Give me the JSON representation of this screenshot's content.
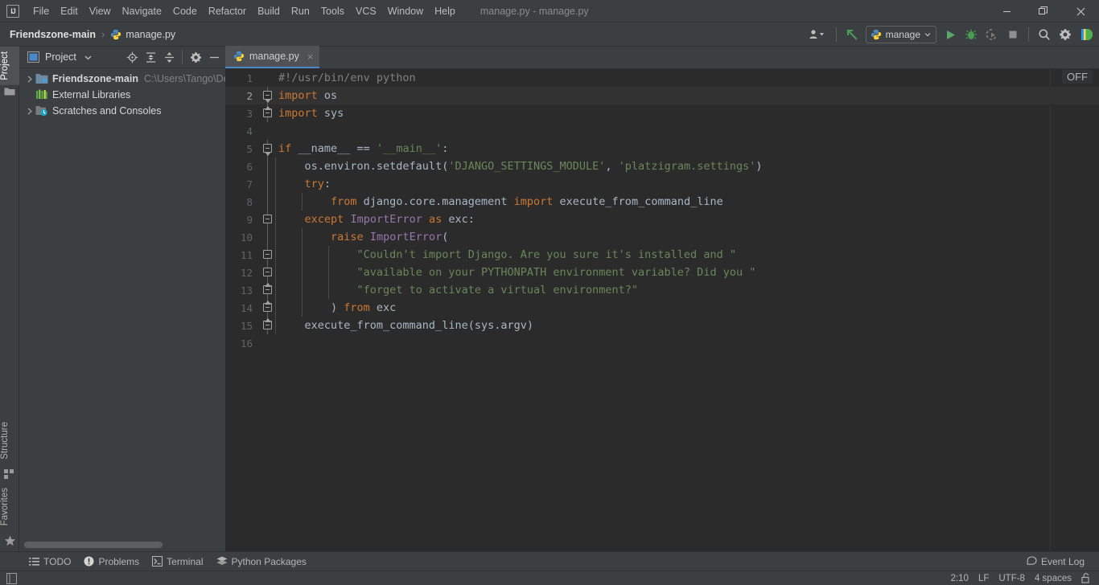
{
  "window": {
    "title": "manage.py - manage.py",
    "controls": {
      "minimize": "minimize-button",
      "maximize": "restore-button",
      "close": "close-button"
    }
  },
  "menubar": {
    "items": [
      {
        "label": "File"
      },
      {
        "label": "Edit"
      },
      {
        "label": "View"
      },
      {
        "label": "Navigate"
      },
      {
        "label": "Code"
      },
      {
        "label": "Refactor"
      },
      {
        "label": "Build"
      },
      {
        "label": "Run"
      },
      {
        "label": "Tools"
      },
      {
        "label": "VCS"
      },
      {
        "label": "Window"
      },
      {
        "label": "Help"
      }
    ]
  },
  "navbar": {
    "breadcrumb": [
      {
        "label": "Friendszone-main",
        "bold": true
      },
      {
        "label": "manage.py",
        "bold": false
      }
    ],
    "separator": "›",
    "run_config": {
      "label": "manage"
    },
    "buttons": [
      {
        "name": "user-accounts-icon",
        "tooltip": "Account"
      },
      {
        "name": "update-project-icon",
        "tooltip": "Update Project"
      },
      {
        "name": "run-button",
        "tooltip": "Run"
      },
      {
        "name": "debug-button",
        "tooltip": "Debug"
      },
      {
        "name": "run-with-coverage-button",
        "tooltip": "Run with Coverage"
      },
      {
        "name": "stop-button",
        "tooltip": "Stop"
      },
      {
        "name": "search-everywhere-icon",
        "tooltip": "Search Everywhere"
      },
      {
        "name": "settings-gear-icon",
        "tooltip": "Settings"
      },
      {
        "name": "ai-assistant-icon",
        "tooltip": "Assistant"
      }
    ]
  },
  "left_stripe": {
    "top_tabs": [
      {
        "label": "Project",
        "active": true
      }
    ],
    "bottom_tabs": [
      {
        "label": "Structure",
        "active": false
      },
      {
        "label": "Favorites",
        "active": false
      }
    ]
  },
  "project_panel": {
    "title": "Project",
    "dropdown": "chevron-down-icon",
    "toolbar_icons": [
      "locate-icon",
      "expand-all-icon",
      "collapse-all-icon",
      "settings-gear-icon",
      "hide-icon"
    ],
    "tree": [
      {
        "label": "Friendszone-main",
        "path": "C:\\Users\\Tango\\Desk",
        "icon": "project-folder-icon",
        "expandable": true,
        "bold": true,
        "indent": 0
      },
      {
        "label": "External Libraries",
        "path": "",
        "icon": "libraries-icon",
        "expandable": false,
        "bold": false,
        "indent": 1
      },
      {
        "label": "Scratches and Consoles",
        "path": "",
        "icon": "scratches-icon",
        "expandable": true,
        "bold": false,
        "indent": 0
      }
    ]
  },
  "editor": {
    "tab": {
      "label": "manage.py",
      "icon": "python-file-icon",
      "close": "×"
    },
    "inspection_widget": "OFF",
    "lines": [
      {
        "n": "1",
        "fold": "none",
        "indent": 0,
        "tokens": [
          {
            "t": "#!/usr/bin/env python",
            "c": "c-cmt"
          }
        ]
      },
      {
        "n": "2",
        "fold": "box-dn",
        "indent": 0,
        "current": true,
        "tokens": [
          {
            "t": "import",
            "c": "c-kw"
          },
          {
            "t": " os",
            "c": "c-txt"
          }
        ]
      },
      {
        "n": "3",
        "fold": "box-up",
        "indent": 0,
        "tokens": [
          {
            "t": "import",
            "c": "c-kw"
          },
          {
            "t": " sys",
            "c": "c-txt"
          }
        ]
      },
      {
        "n": "4",
        "fold": "none",
        "indent": 0,
        "tokens": []
      },
      {
        "n": "5",
        "fold": "box-dn",
        "indent": 0,
        "tokens": [
          {
            "t": "if",
            "c": "c-kw"
          },
          {
            "t": " __name__ == ",
            "c": "c-txt"
          },
          {
            "t": "'__main__'",
            "c": "c-str"
          },
          {
            "t": ":",
            "c": "c-txt"
          }
        ]
      },
      {
        "n": "6",
        "fold": "line",
        "indent": 1,
        "tokens": [
          {
            "t": "    os.environ.setdefault(",
            "c": "c-txt"
          },
          {
            "t": "'DJANGO_SETTINGS_MODULE'",
            "c": "c-str"
          },
          {
            "t": ", ",
            "c": "c-txt"
          },
          {
            "t": "'platzigram.settings'",
            "c": "c-str"
          },
          {
            "t": ")",
            "c": "c-txt"
          }
        ]
      },
      {
        "n": "7",
        "fold": "line",
        "indent": 1,
        "tokens": [
          {
            "t": "    ",
            "c": "c-txt"
          },
          {
            "t": "try",
            "c": "c-kw"
          },
          {
            "t": ":",
            "c": "c-txt"
          }
        ]
      },
      {
        "n": "8",
        "fold": "line",
        "indent": 2,
        "tokens": [
          {
            "t": "        ",
            "c": "c-txt"
          },
          {
            "t": "from",
            "c": "c-kw"
          },
          {
            "t": " django.core.management ",
            "c": "c-txt"
          },
          {
            "t": "import",
            "c": "c-kw"
          },
          {
            "t": " execute_from_command_line",
            "c": "c-txt"
          }
        ]
      },
      {
        "n": "9",
        "fold": "box-mid",
        "indent": 1,
        "tokens": [
          {
            "t": "    ",
            "c": "c-txt"
          },
          {
            "t": "except",
            "c": "c-kw"
          },
          {
            "t": " ",
            "c": "c-txt"
          },
          {
            "t": "ImportError",
            "c": "c-cls"
          },
          {
            "t": " ",
            "c": "c-txt"
          },
          {
            "t": "as",
            "c": "c-kw"
          },
          {
            "t": " exc:",
            "c": "c-txt"
          }
        ]
      },
      {
        "n": "10",
        "fold": "line",
        "indent": 2,
        "tokens": [
          {
            "t": "        ",
            "c": "c-txt"
          },
          {
            "t": "raise",
            "c": "c-kw"
          },
          {
            "t": " ",
            "c": "c-txt"
          },
          {
            "t": "ImportError",
            "c": "c-cls"
          },
          {
            "t": "(",
            "c": "c-txt"
          }
        ]
      },
      {
        "n": "11",
        "fold": "box-mid",
        "indent": 3,
        "tokens": [
          {
            "t": "            ",
            "c": "c-txt"
          },
          {
            "t": "\"Couldn't import Django. Are you sure it's installed and \"",
            "c": "c-str"
          }
        ]
      },
      {
        "n": "12",
        "fold": "box-mid",
        "indent": 3,
        "tokens": [
          {
            "t": "            ",
            "c": "c-txt"
          },
          {
            "t": "\"available on your PYTHONPATH environment variable? Did you \"",
            "c": "c-str"
          }
        ]
      },
      {
        "n": "13",
        "fold": "box-up",
        "indent": 3,
        "tokens": [
          {
            "t": "            ",
            "c": "c-txt"
          },
          {
            "t": "\"forget to activate a virtual environment?\"",
            "c": "c-str"
          }
        ]
      },
      {
        "n": "14",
        "fold": "box-up",
        "indent": 2,
        "tokens": [
          {
            "t": "        ) ",
            "c": "c-txt"
          },
          {
            "t": "from",
            "c": "c-kw"
          },
          {
            "t": " exc",
            "c": "c-txt"
          }
        ]
      },
      {
        "n": "15",
        "fold": "box-up",
        "indent": 1,
        "tokens": [
          {
            "t": "    execute_from_command_line(sys.argv)",
            "c": "c-txt"
          }
        ]
      },
      {
        "n": "16",
        "fold": "none",
        "indent": 0,
        "tokens": []
      }
    ]
  },
  "bottom_bar": {
    "items": [
      {
        "label": "TODO",
        "icon": "todo-list-icon"
      },
      {
        "label": "Problems",
        "icon": "problems-icon"
      },
      {
        "label": "Terminal",
        "icon": "terminal-icon"
      },
      {
        "label": "Python Packages",
        "icon": "python-packages-icon"
      }
    ],
    "event_log": {
      "label": "Event Log",
      "icon": "event-log-icon"
    }
  },
  "status_bar": {
    "layout_icon": "layout-toggle-icon",
    "caret_position": "2:10",
    "line_separator": "LF",
    "encoding": "UTF-8",
    "indent": "4 spaces",
    "lock_icon": "unlocked-icon"
  },
  "colors": {
    "chrome": "#3c3f41",
    "editor_bg": "#2b2b2b",
    "accent_blue": "#4a88c7",
    "keyword": "#cc7832",
    "string": "#6a8759",
    "class_name": "#9876aa",
    "comment": "#808080",
    "default_text": "#a9b7c6",
    "run_green": "#59a869"
  }
}
